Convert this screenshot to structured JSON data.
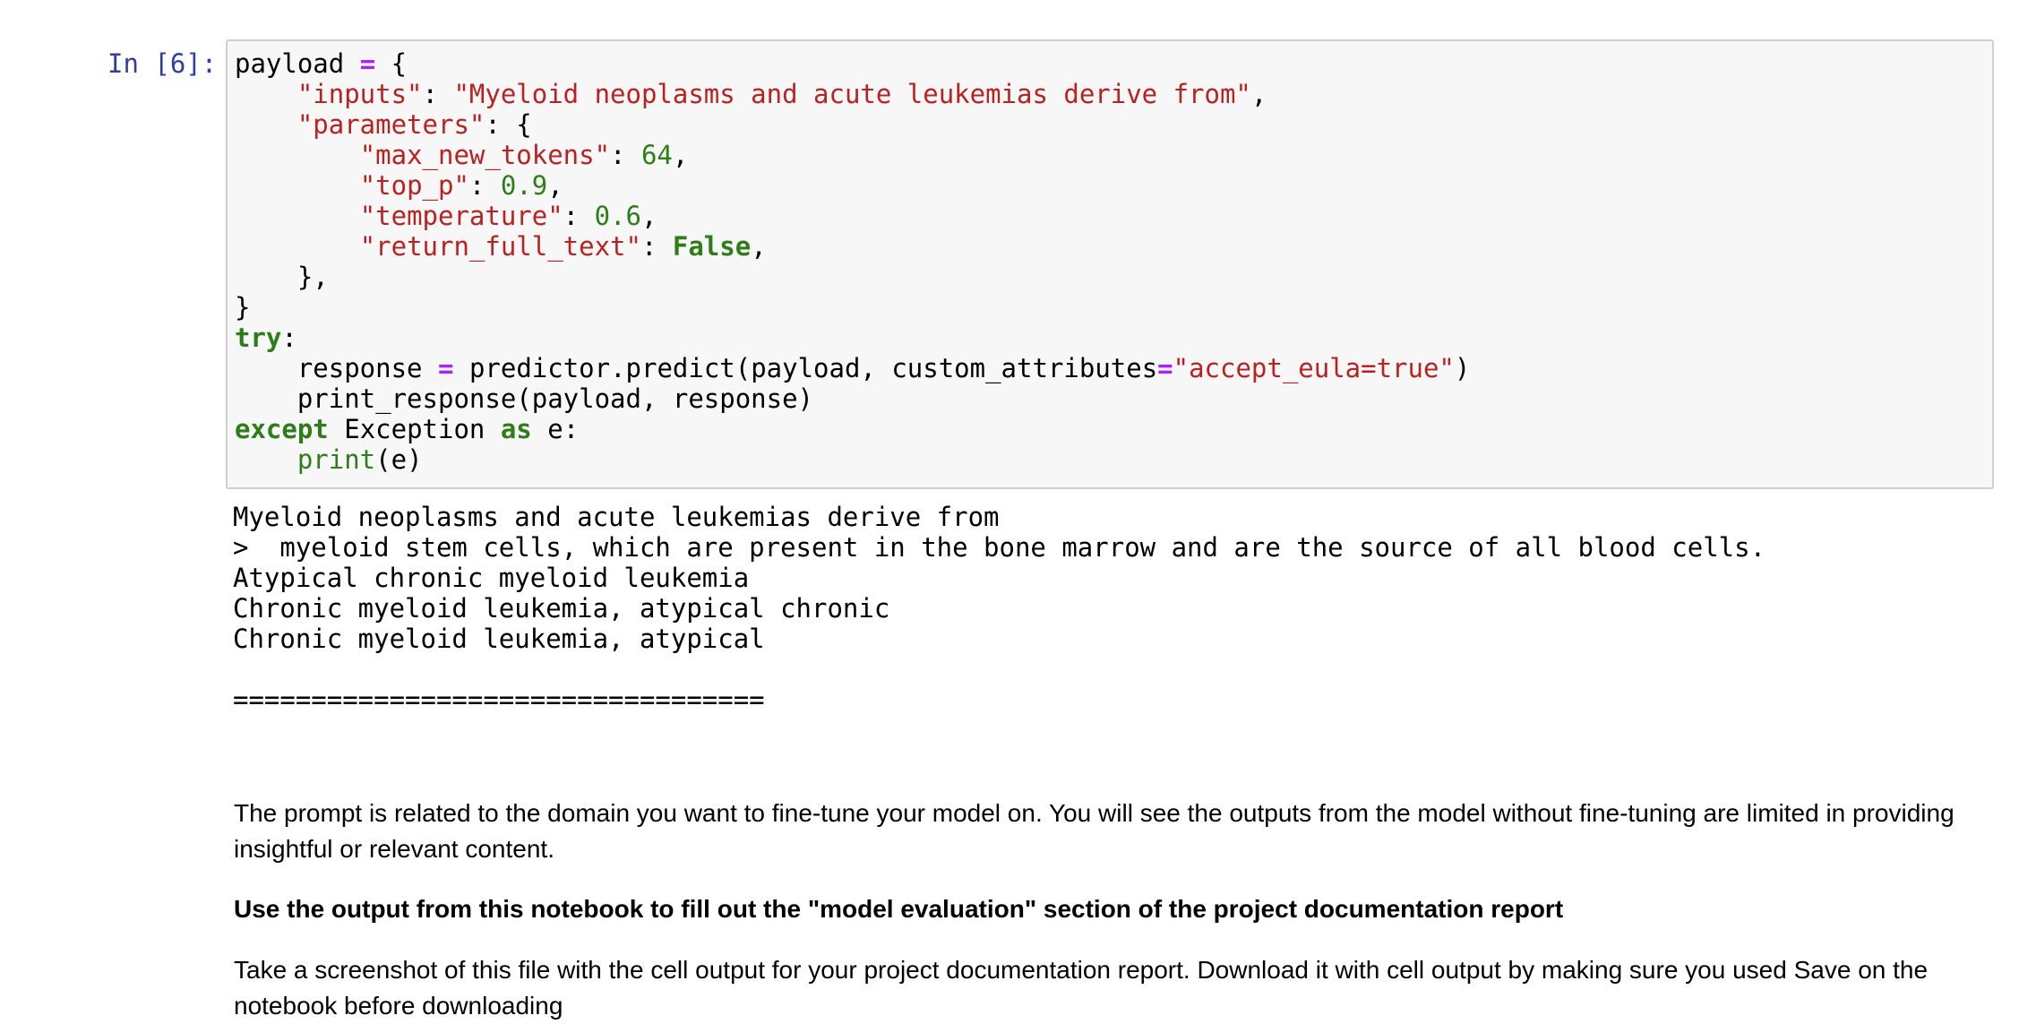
{
  "cell": {
    "prompt": "In [6]:",
    "code": {
      "payload_name": "payload",
      "inputs_key": "\"inputs\"",
      "inputs_value": "\"Myeloid neoplasms and acute leukemias derive from\"",
      "parameters_key": "\"parameters\"",
      "max_new_tokens_key": "\"max_new_tokens\"",
      "max_new_tokens_value": "64",
      "top_p_key": "\"top_p\"",
      "top_p_value": "0.9",
      "temperature_key": "\"temperature\"",
      "temperature_value": "0.6",
      "return_full_text_key": "\"return_full_text\"",
      "return_full_text_value": "False",
      "try_kw": "try",
      "response_var": "response",
      "predict_call": "predictor.predict(payload, custom_attributes",
      "custom_attr_value": "\"accept_eula=true\"",
      "print_response_call": "print_response(payload, response)",
      "except_kw": "except",
      "exception_name": "Exception",
      "as_kw": "as",
      "exception_var": "e",
      "print_builtin": "print",
      "print_arg": "(e)"
    }
  },
  "output": {
    "lines": [
      "Myeloid neoplasms and acute leukemias derive from",
      ">  myeloid stem cells, which are present in the bone marrow and are the source of all blood cells.",
      "Atypical chronic myeloid leukemia",
      "Chronic myeloid leukemia, atypical chronic",
      "Chronic myeloid leukemia, atypical",
      "",
      "=================================="
    ]
  },
  "markdown": {
    "paragraph1": "The prompt is related to the domain you want to fine-tune your model on. You will see the outputs from the model without fine-tuning are limited in providing insightful or relevant content.",
    "paragraph2": "Use the output from this notebook to fill out the \"model evaluation\" section of the project documentation report",
    "paragraph3": "Take a screenshot of this file with the cell output for your project documentation report. Download it with cell output by making sure you used Save on the notebook before downloading"
  },
  "colors": {
    "keyword": "#2e7d1a",
    "string": "#ba2121",
    "number": "#2e7d1a",
    "operator": "#aa22ff",
    "prompt": "#303f9f",
    "input_background": "#f7f7f7"
  }
}
